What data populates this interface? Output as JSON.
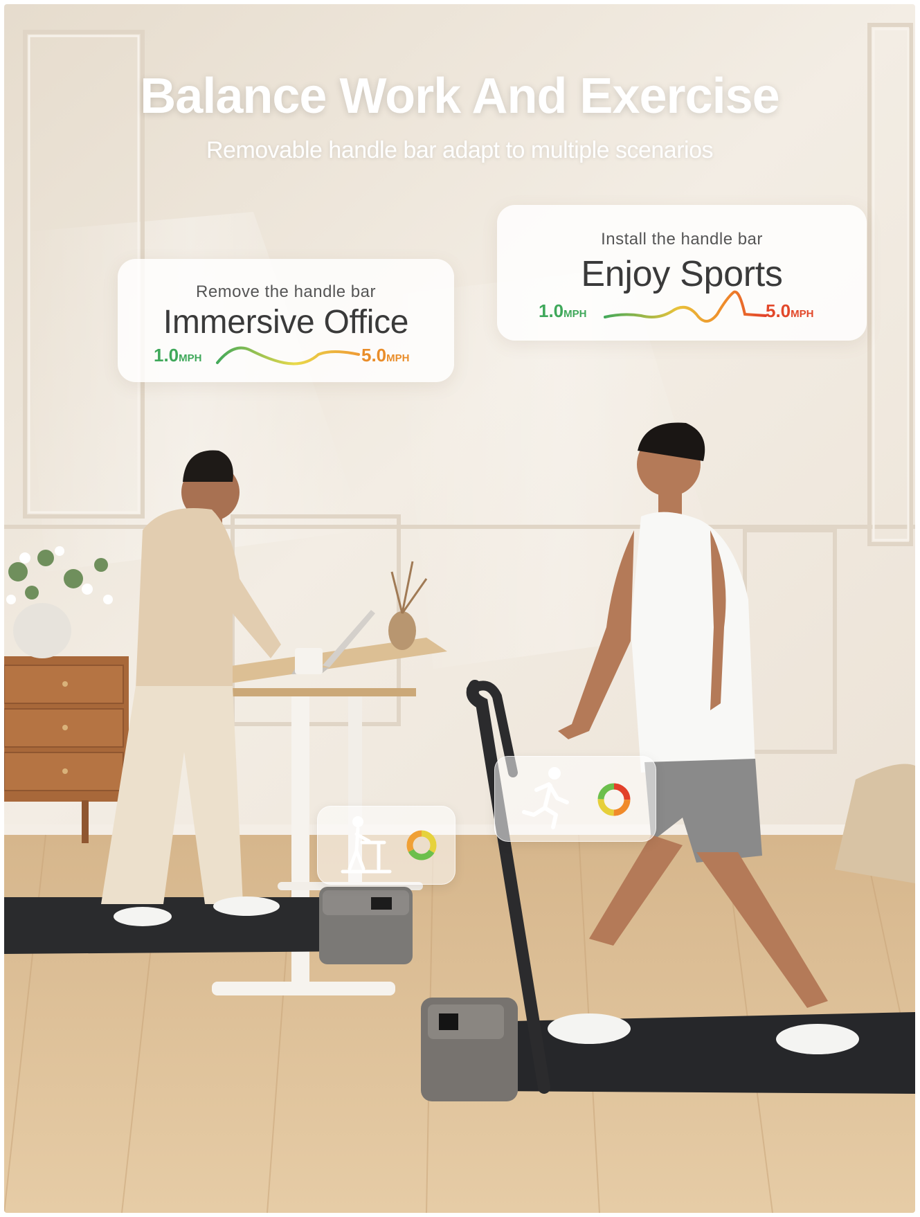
{
  "header": {
    "title": "Balance Work And Exercise",
    "subtitle": "Removable handle bar adapt to multiple scenarios"
  },
  "cards": {
    "office": {
      "caption": "Remove the handle bar",
      "label": "Immersive Office",
      "speed_min": "1.0",
      "speed_max": "5.0",
      "unit": "MPH"
    },
    "sports": {
      "caption": "Install the handle bar",
      "label": "Enjoy Sports",
      "speed_min": "1.0",
      "speed_max": "5.0",
      "unit": "MPH"
    }
  },
  "icons": [
    "desk-walking-icon",
    "progress-ring-icon",
    "running-icon",
    "progress-ring-icon"
  ],
  "colors": {
    "wall": "#efe7dc",
    "floor": "#d9b98f",
    "belt": "#2a2b2d",
    "speed_green": "#3fa85a",
    "speed_orange": "#e98d2a",
    "speed_red": "#e2482a"
  }
}
